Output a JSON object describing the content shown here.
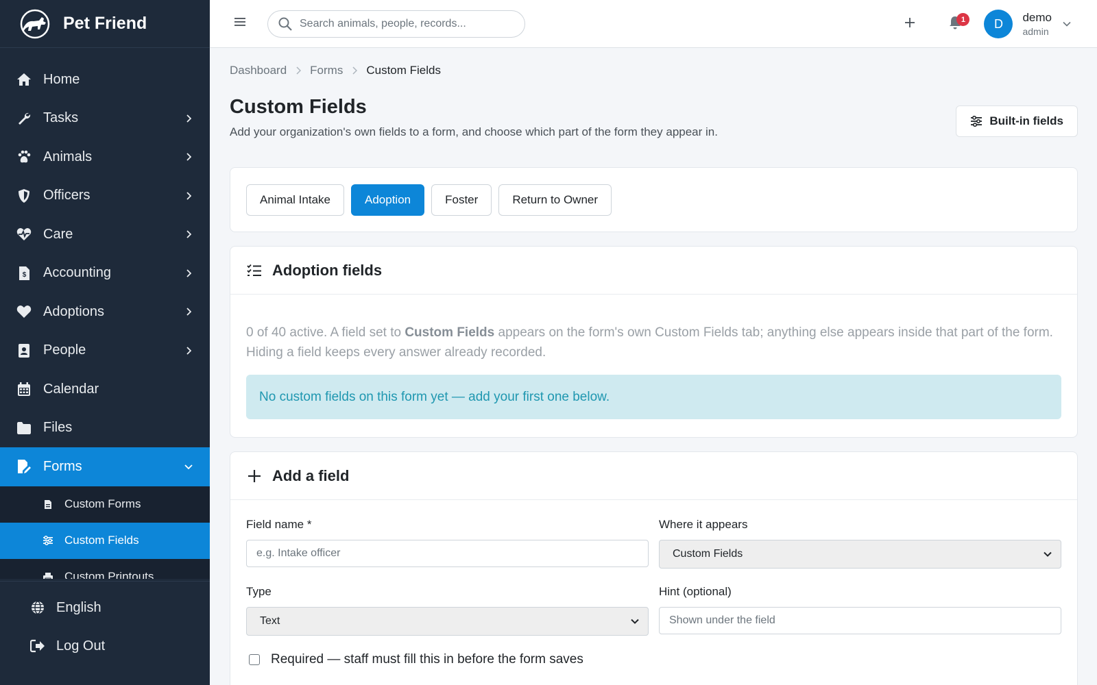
{
  "app": {
    "name": "Pet Friend"
  },
  "sidebar": {
    "items": [
      {
        "label": "Home",
        "icon": "home-icon",
        "has_children": false
      },
      {
        "label": "Tasks",
        "icon": "wrench-icon",
        "has_children": true
      },
      {
        "label": "Animals",
        "icon": "paw-icon",
        "has_children": true
      },
      {
        "label": "Officers",
        "icon": "shield-icon",
        "has_children": true
      },
      {
        "label": "Care",
        "icon": "heart-pulse-icon",
        "has_children": true
      },
      {
        "label": "Accounting",
        "icon": "invoice-icon",
        "has_children": true
      },
      {
        "label": "Adoptions",
        "icon": "heart-icon",
        "has_children": true
      },
      {
        "label": "People",
        "icon": "contact-card-icon",
        "has_children": true
      },
      {
        "label": "Calendar",
        "icon": "calendar-icon",
        "has_children": false
      },
      {
        "label": "Files",
        "icon": "folder-icon",
        "has_children": false
      },
      {
        "label": "Forms",
        "icon": "form-edit-icon",
        "has_children": true,
        "expanded": true,
        "active": true
      }
    ],
    "sub_items": [
      {
        "label": "Custom Forms",
        "icon": "file-icon"
      },
      {
        "label": "Custom Fields",
        "icon": "sliders-icon",
        "active": true
      },
      {
        "label": "Custom Printouts",
        "icon": "printer-icon"
      }
    ],
    "footer": [
      {
        "label": "English",
        "icon": "globe-icon"
      },
      {
        "label": "Log Out",
        "icon": "logout-icon"
      }
    ]
  },
  "topbar": {
    "search_placeholder": "Search animals, people, records...",
    "notification_count": "1",
    "user": {
      "initial": "D",
      "name": "demo",
      "role": "admin"
    }
  },
  "breadcrumb": [
    "Dashboard",
    "Forms",
    "Custom Fields"
  ],
  "page": {
    "title": "Custom Fields",
    "subtitle": "Add your organization's own fields to a form, and choose which part of the form they appear in.",
    "builtin_button": "Built-in fields"
  },
  "tabs": [
    {
      "label": "Animal Intake",
      "active": false
    },
    {
      "label": "Adoption",
      "active": true
    },
    {
      "label": "Foster",
      "active": false
    },
    {
      "label": "Return to Owner",
      "active": false
    }
  ],
  "fields_card": {
    "title": "Adoption fields",
    "desc_part1": "0 of 40 active. A field set to ",
    "desc_bold": "Custom Fields",
    "desc_part2": " appears on the form's own Custom Fields tab; anything else appears inside that part of the form. Hiding a field keeps every answer already recorded.",
    "empty_alert": "No custom fields on this form yet — add your first one below."
  },
  "add_card": {
    "title": "Add a field",
    "field_name_label": "Field name *",
    "field_name_placeholder": "e.g. Intake officer",
    "where_label": "Where it appears",
    "where_value": "Custom Fields",
    "type_label": "Type",
    "type_value": "Text",
    "hint_label": "Hint (optional)",
    "hint_placeholder": "Shown under the field",
    "required_label": "Required — staff must fill this in before the form saves"
  },
  "colors": {
    "sidebar_bg": "#1e2a3a",
    "accent": "#0d86d8",
    "alert_bg": "#cfeaf0",
    "alert_text": "#1f97b0",
    "badge": "#dc3545"
  }
}
